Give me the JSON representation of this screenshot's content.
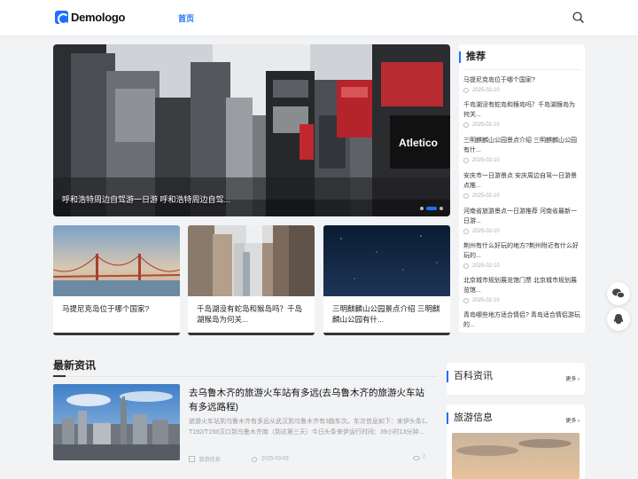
{
  "header": {
    "logo_text": "Demologo",
    "nav_home": "首页"
  },
  "banner": {
    "caption": "呼和浩特周边自驾游一日游 呼和浩特周边自驾..."
  },
  "cards": [
    {
      "title": "马提尼克岛位于哪个国家?"
    },
    {
      "title": "千岛湖没有蛇岛和猴岛吗？千岛湖猴岛为何关..."
    },
    {
      "title": "三明麒麟山公园景点介绍 三明麒麟山公园有什..."
    }
  ],
  "recommend": {
    "title": "推荐",
    "items": [
      {
        "title": "马提尼克岛位于哪个国家?",
        "date": "2025-02-10"
      },
      {
        "title": "千岛湖没有蛇岛和猴岛吗？千岛湖猴岛为何关...",
        "date": "2025-02-10"
      },
      {
        "title": "三明麒麟山公园景点介绍 三明麒麟山公园有什...",
        "date": "2025-02-10"
      },
      {
        "title": "安庆市一日游景点 安庆周边自驾一日游景点推...",
        "date": "2025-02-10"
      },
      {
        "title": "河南省旅游景点一日游推荐 河南省最新一日游...",
        "date": "2025-02-10"
      },
      {
        "title": "荆州有什么好玩的地方?荆州附近有什么好玩的...",
        "date": "2025-02-10"
      },
      {
        "title": "北京城市规划展览馆门票 北京城市规划展览馆...",
        "date": "2025-02-10"
      },
      {
        "title": "青岛哪些地方适合情侣? 青岛适合情侣游玩的...",
        "date": ""
      }
    ]
  },
  "news": {
    "title": "最新资讯",
    "article": {
      "title": "去乌鲁木齐的旅游火车站有多远(去乌鲁木齐的旅游火车站有多远路程)",
      "desc": "旅游火车站到乌鲁木齐有多远从武汉到乌鲁木齐有3趟车次。车次信息如下：来伊头条1、T192/T193汉口到乌鲁木齐南（到达第三天）今日头条来伊运行时间：39小时13分钟...",
      "category": "旅游信息",
      "date": "2025-03-03",
      "views": "7"
    }
  },
  "sidebar": {
    "box1": {
      "title": "百科资讯",
      "more": "更多"
    },
    "box2": {
      "title": "旅游信息",
      "more": "更多"
    }
  }
}
